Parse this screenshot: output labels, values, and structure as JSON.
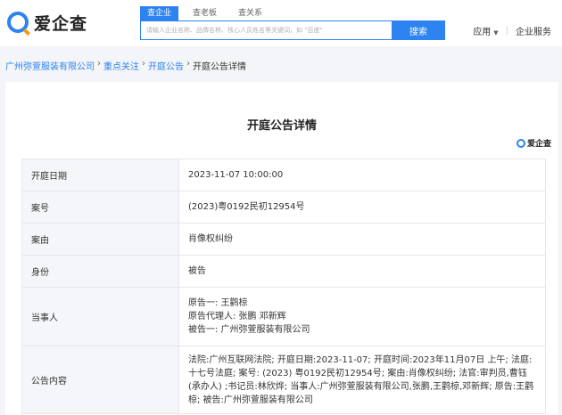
{
  "header": {
    "logo_text": "爱企查",
    "tabs": [
      {
        "label": "查企业"
      },
      {
        "label": "查老板"
      },
      {
        "label": "查关系"
      }
    ],
    "search_placeholder": "请输入企业名称、品牌名称、核心人员姓名等关键词，如 \"百度\"",
    "search_button": "搜索",
    "nav": {
      "apps": "应用",
      "enterprise_service": "企业服务"
    }
  },
  "breadcrumb": {
    "items": [
      "广州弥萱服装有限公司",
      "重点关注",
      "开庭公告"
    ],
    "current": "开庭公告详情"
  },
  "page": {
    "title": "开庭公告详情",
    "mini_logo": "爱企查"
  },
  "details": [
    {
      "label": "开庭日期",
      "value": "2023-11-07 10:00:00"
    },
    {
      "label": "案号",
      "value": "(2023)粤0192民初12954号"
    },
    {
      "label": "案由",
      "value": "肖像权纠纷"
    },
    {
      "label": "身份",
      "value": "被告"
    },
    {
      "label": "当事人",
      "lines": [
        "原告一: 王鹳椋",
        "原告代理人: 张鹏 邓新辉",
        "被告一: 广州弥萱服装有限公司"
      ]
    },
    {
      "label": "公告内容",
      "value": "法院:广州互联网法院; 开庭日期:2023-11-07; 开庭时间:2023年11月07日 上午; 法庭:十七号法庭; 案号: (2023) 粤0192民初12954号; 案由:肖像权纠纷; 法官:审判员,曹钰 (承办人) ;书记员:林欣烨; 当事人:广州弥萱服装有限公司,张鹏,王鹳椋,邓新辉; 原告:王鹳椋; 被告:广州弥萱服装有限公司"
    }
  ]
}
